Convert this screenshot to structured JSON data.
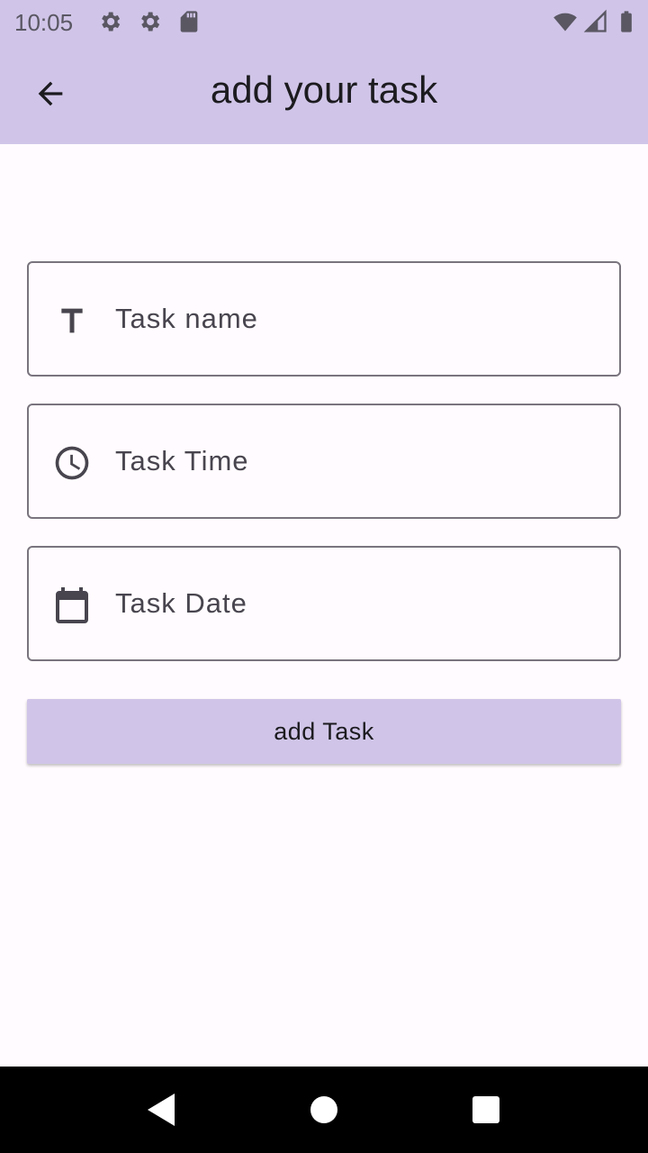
{
  "status_bar": {
    "time": "10:05",
    "left_icons": [
      "gear-icon",
      "gear-icon",
      "sd-card-icon"
    ],
    "right_icons": [
      "wifi-icon",
      "signal-icon",
      "battery-icon"
    ]
  },
  "app_bar": {
    "title": "add your task",
    "back_icon": "arrow-back-icon",
    "background": "#d0c5e8"
  },
  "form": {
    "fields": [
      {
        "label": "Task name",
        "icon": "text-fields-icon"
      },
      {
        "label": "Task Time",
        "icon": "clock-icon"
      },
      {
        "label": "Task Date",
        "icon": "calendar-icon"
      }
    ],
    "submit_label": "add Task"
  },
  "nav_bar": {
    "buttons": [
      "back-triangle-icon",
      "home-circle-icon",
      "recents-square-icon"
    ]
  }
}
